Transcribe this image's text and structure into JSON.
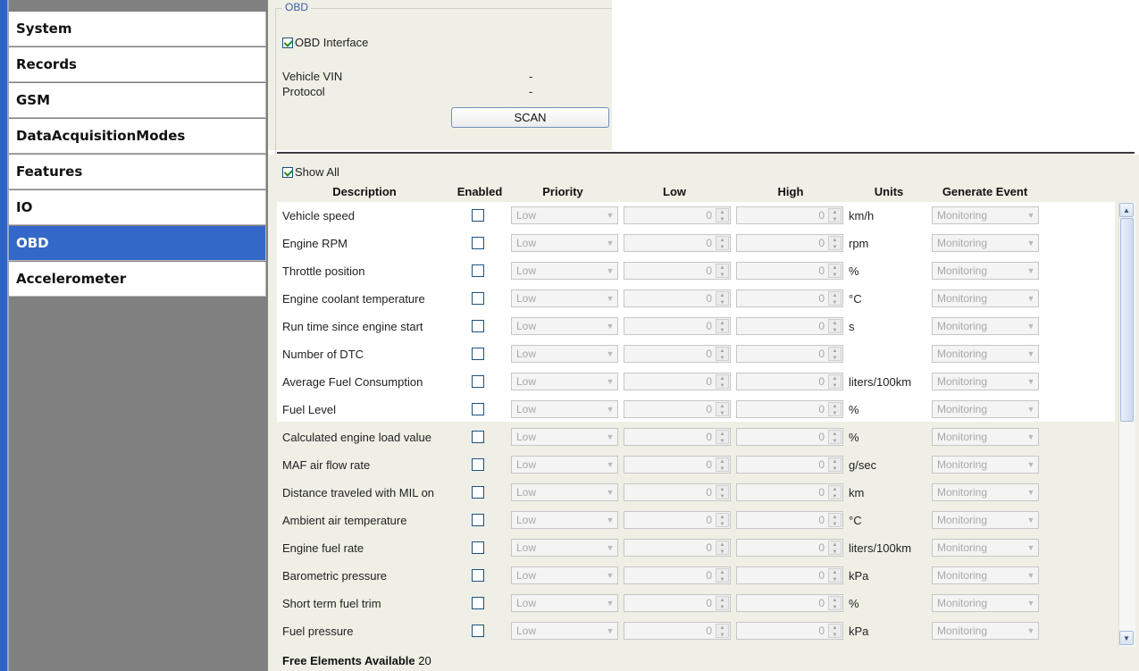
{
  "sidebar": {
    "items": [
      "System",
      "Records",
      "GSM",
      "DataAcquisitionModes",
      "Features",
      "IO",
      "OBD",
      "Accelerometer"
    ],
    "active": "OBD"
  },
  "obd_group": {
    "title": "OBD",
    "interface_label": "OBD Interface",
    "interface_checked": true,
    "vin_label": "Vehicle VIN",
    "vin_value": "-",
    "protocol_label": "Protocol",
    "protocol_value": "-",
    "scan_label": "SCAN"
  },
  "table": {
    "show_all_label": "Show All",
    "show_all_checked": true,
    "headers": {
      "description": "Description",
      "enabled": "Enabled",
      "priority": "Priority",
      "low": "Low",
      "high": "High",
      "units": "Units",
      "generate_event": "Generate Event"
    },
    "rows": [
      {
        "description": "Vehicle speed",
        "priority": "Low",
        "low": "0",
        "high": "0",
        "units": "km/h",
        "event": "Monitoring"
      },
      {
        "description": "Engine RPM",
        "priority": "Low",
        "low": "0",
        "high": "0",
        "units": "rpm",
        "event": "Monitoring"
      },
      {
        "description": "Throttle position",
        "priority": "Low",
        "low": "0",
        "high": "0",
        "units": "%",
        "event": "Monitoring"
      },
      {
        "description": "Engine coolant temperature",
        "priority": "Low",
        "low": "0",
        "high": "0",
        "units": "°C",
        "event": "Monitoring"
      },
      {
        "description": "Run time since engine start",
        "priority": "Low",
        "low": "0",
        "high": "0",
        "units": "s",
        "event": "Monitoring"
      },
      {
        "description": "Number of DTC",
        "priority": "Low",
        "low": "0",
        "high": "0",
        "units": "",
        "event": "Monitoring"
      },
      {
        "description": "Average Fuel Consumption",
        "priority": "Low",
        "low": "0",
        "high": "0",
        "units": "liters/100km",
        "event": "Monitoring"
      },
      {
        "description": "Fuel Level",
        "priority": "Low",
        "low": "0",
        "high": "0",
        "units": "%",
        "event": "Monitoring"
      },
      {
        "description": "Calculated engine load value",
        "priority": "Low",
        "low": "0",
        "high": "0",
        "units": "%",
        "event": "Monitoring"
      },
      {
        "description": "MAF air flow rate",
        "priority": "Low",
        "low": "0",
        "high": "0",
        "units": "g/sec",
        "event": "Monitoring"
      },
      {
        "description": "Distance traveled with MIL on",
        "priority": "Low",
        "low": "0",
        "high": "0",
        "units": "km",
        "event": "Monitoring"
      },
      {
        "description": "Ambient air temperature",
        "priority": "Low",
        "low": "0",
        "high": "0",
        "units": "°C",
        "event": "Monitoring"
      },
      {
        "description": "Engine fuel rate",
        "priority": "Low",
        "low": "0",
        "high": "0",
        "units": "liters/100km",
        "event": "Monitoring"
      },
      {
        "description": "Barometric pressure",
        "priority": "Low",
        "low": "0",
        "high": "0",
        "units": "kPa",
        "event": "Monitoring"
      },
      {
        "description": "Short term fuel trim",
        "priority": "Low",
        "low": "0",
        "high": "0",
        "units": "%",
        "event": "Monitoring"
      },
      {
        "description": "Fuel pressure",
        "priority": "Low",
        "low": "0",
        "high": "0",
        "units": "kPa",
        "event": "Monitoring"
      }
    ]
  },
  "footer": {
    "free_label": "Free Elements Available",
    "free_count": "20"
  },
  "icons": {
    "dropdown": "chevron-down-icon",
    "spinner": "spinner-arrows-icon",
    "scroll_up": "scroll-up-arrow-icon",
    "scroll_down": "scroll-down-arrow-icon"
  },
  "colors": {
    "active_nav": "#3468c8",
    "panel_bg": "#efefe6",
    "group_title": "#3a5da8"
  }
}
